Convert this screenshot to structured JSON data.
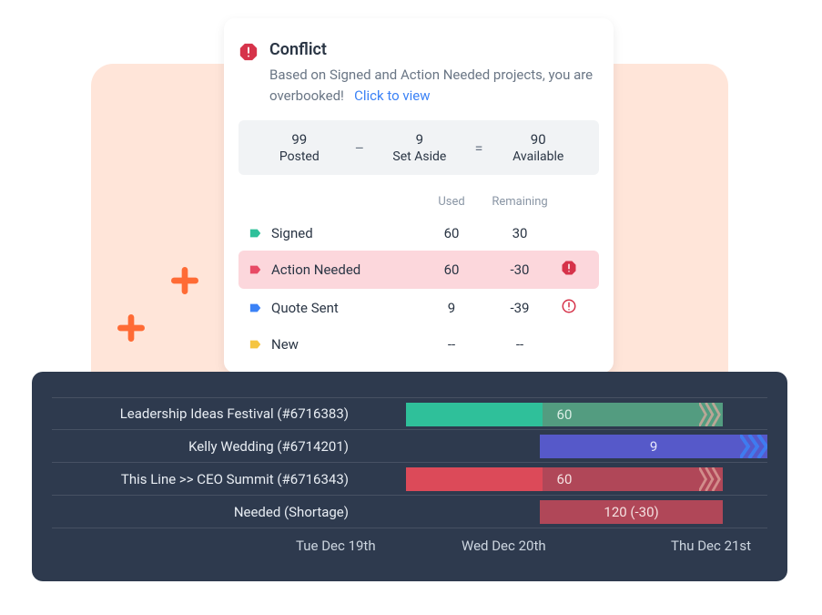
{
  "conflict": {
    "title": "Conflict",
    "description": "Based on Signed and Action Needed projects, you are overbooked!",
    "link_label": "Click to view"
  },
  "equation": {
    "posted_num": "99",
    "posted_label": "Posted",
    "setaside_num": "9",
    "setaside_label": "Set Aside",
    "available_num": "90",
    "available_label": "Available"
  },
  "table": {
    "header_used": "Used",
    "header_remaining": "Remaining",
    "rows": [
      {
        "label": "Signed",
        "used": "60",
        "remaining": "30",
        "color": "#2fc09a"
      },
      {
        "label": "Action Needed",
        "used": "60",
        "remaining": "-30",
        "color": "#e84a65"
      },
      {
        "label": "Quote Sent",
        "used": "9",
        "remaining": "-39",
        "color": "#3b82f6"
      },
      {
        "label": "New",
        "used": "--",
        "remaining": "--",
        "color": "#f5c542"
      }
    ]
  },
  "gantt": {
    "rows": [
      {
        "label": "Leadership Ideas Festival (#6716383)",
        "value": "60"
      },
      {
        "label": "Kelly Wedding (#6714201)",
        "value": "9"
      },
      {
        "label": "This Line >> CEO Summit (#6716343)",
        "value": "60"
      },
      {
        "label": "Needed (Shortage)",
        "value": "120 (-30)"
      }
    ],
    "axis": [
      "Tue Dec 19th",
      "Wed Dec 20th",
      "Thu Dec 21st"
    ]
  }
}
